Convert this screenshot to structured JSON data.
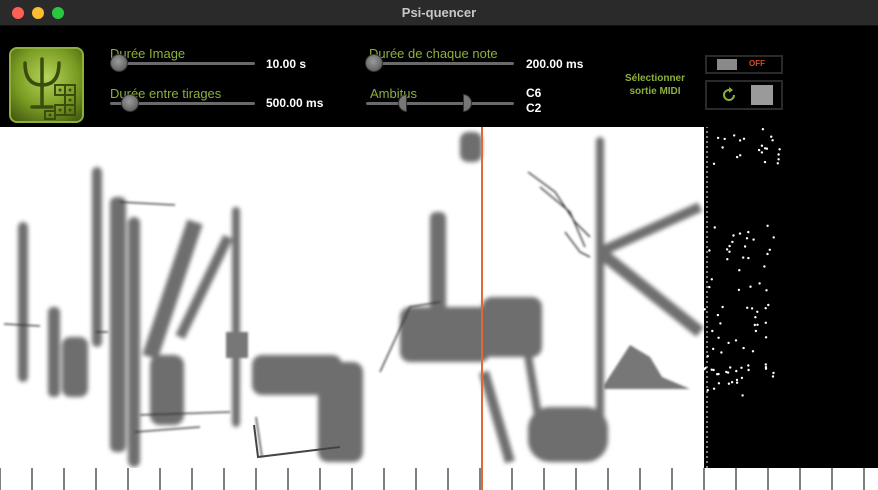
{
  "window": {
    "title": "Psi-quencer"
  },
  "controls": {
    "image_duration": {
      "label": "Durée Image",
      "value": "10.00 s",
      "level": 0.05
    },
    "draw_interval": {
      "label": "Durée entre tirages",
      "value": "500.00 ms",
      "level": 0.08
    },
    "note_duration": {
      "label": "Durée de chaque note",
      "value": "200.00 ms",
      "level": 0.05
    },
    "range": {
      "label": "Ambitus",
      "high": "C6",
      "low": "C2"
    }
  },
  "midi": {
    "label_line1": "Sélectionner",
    "label_line2": "sortie MIDI",
    "toggle_state": "OFF"
  },
  "colors": {
    "accent_green": "#8cb03a",
    "playhead": "#e0693a",
    "toggle_text": "#d64a2a"
  },
  "icons": {
    "logo": "psi-logo",
    "refresh": "refresh-icon"
  },
  "playhead": {
    "position": 0.685
  }
}
